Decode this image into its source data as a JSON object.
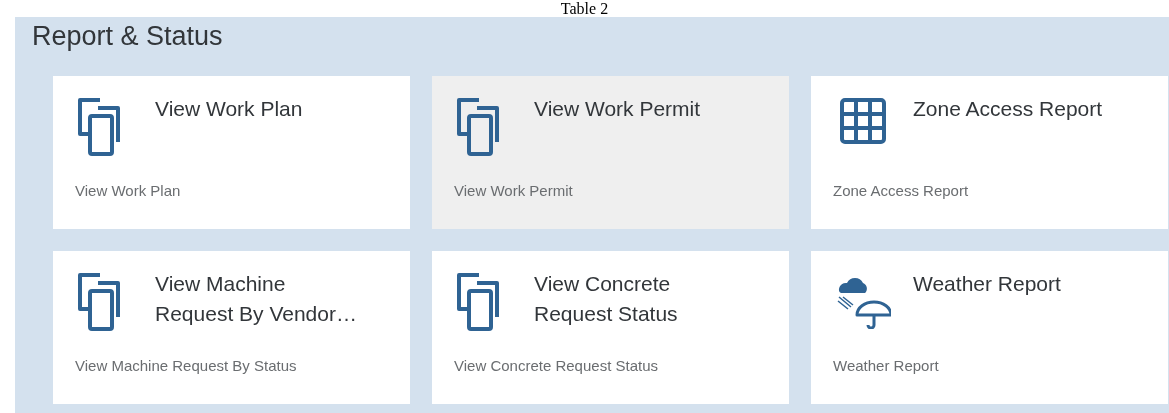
{
  "caption": "Table 2",
  "group": {
    "title": "Report & Status",
    "tiles": [
      {
        "title": "View Work Plan",
        "subtitle": "View Work Plan",
        "kind": "copy",
        "selected": false
      },
      {
        "title": "View Work Permit",
        "subtitle": "View Work Permit",
        "kind": "copy",
        "selected": true
      },
      {
        "title": "Zone Access Report",
        "subtitle": "Zone Access Report",
        "kind": "grid",
        "selected": false
      },
      {
        "title": "View Machine Request By Vendor…",
        "subtitle": "View Machine Request By Status",
        "kind": "copy",
        "selected": false
      },
      {
        "title": "View Concrete Request Status",
        "subtitle": "View Concrete Request Status",
        "kind": "copy",
        "selected": false
      },
      {
        "title": "Weather Report",
        "subtitle": "Weather Report",
        "kind": "weather",
        "selected": false
      }
    ]
  }
}
